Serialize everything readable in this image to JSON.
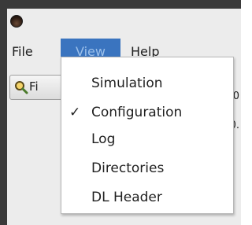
{
  "menubar": {
    "file": "File",
    "view": "View",
    "help": "Help"
  },
  "toolbar": {
    "find_label": "Fi",
    "find_icon": "magnifier-icon"
  },
  "side_text": {
    "line1": "0",
    "line2": "0."
  },
  "view_menu": {
    "items": [
      {
        "label": "Simulation",
        "checked": false
      },
      {
        "label": "Configuration",
        "checked": true
      },
      {
        "label": "Log",
        "checked": false
      },
      {
        "label": "Directories",
        "checked": false
      },
      {
        "label": "DL Header",
        "checked": false
      }
    ],
    "check_glyph": "✓"
  },
  "colors": {
    "menu_highlight": "#3a74bf",
    "menu_highlight_text": "#9cc0ea",
    "frame": "#3a3a3a"
  }
}
